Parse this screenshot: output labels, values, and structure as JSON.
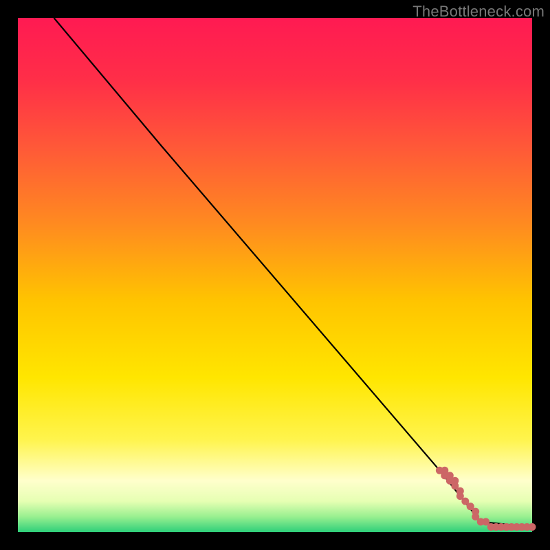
{
  "watermark": "TheBottleneck.com",
  "colors": {
    "frame": "#000000",
    "line": "#000000",
    "marker": "#cc6666",
    "gradient_stops": [
      {
        "offset": 0.0,
        "color": "#ff1a52"
      },
      {
        "offset": 0.12,
        "color": "#ff2e48"
      },
      {
        "offset": 0.25,
        "color": "#ff5838"
      },
      {
        "offset": 0.4,
        "color": "#ff8a20"
      },
      {
        "offset": 0.55,
        "color": "#ffc400"
      },
      {
        "offset": 0.7,
        "color": "#ffe600"
      },
      {
        "offset": 0.82,
        "color": "#fff44d"
      },
      {
        "offset": 0.9,
        "color": "#ffffcc"
      },
      {
        "offset": 0.94,
        "color": "#e6ffb3"
      },
      {
        "offset": 0.97,
        "color": "#99f090"
      },
      {
        "offset": 1.0,
        "color": "#2ecf7a"
      }
    ]
  },
  "chart_data": {
    "type": "line",
    "title": "",
    "xlabel": "",
    "ylabel": "",
    "xlim": [
      0,
      100
    ],
    "ylim": [
      0,
      100
    ],
    "series": [
      {
        "name": "curve",
        "x": [
          7,
          28,
          82,
          90,
          100
        ],
        "y": [
          100,
          75,
          12,
          2,
          1
        ],
        "style": "line"
      },
      {
        "name": "markers",
        "x": [
          82,
          83,
          83,
          84,
          84,
          85,
          85,
          86,
          86,
          87,
          88,
          88,
          89,
          89,
          90,
          91,
          92,
          93,
          94,
          95,
          95,
          96,
          97,
          98,
          99,
          100
        ],
        "y": [
          12,
          12,
          11,
          11,
          10,
          10,
          9,
          8,
          7,
          6,
          5,
          5,
          4,
          3,
          2,
          2,
          1,
          1,
          1,
          1,
          1,
          1,
          1,
          1,
          1,
          1
        ],
        "style": "markers"
      }
    ]
  }
}
